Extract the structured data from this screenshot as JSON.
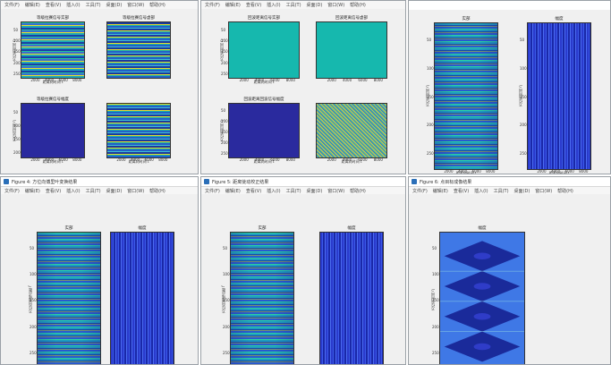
{
  "windows": [
    {
      "id": "w1",
      "title": "",
      "menus": [],
      "panels": [
        {
          "title": "等级拉赛信号实部",
          "style": "stripes-h",
          "xlabel": "距离向时间 t",
          "ylabel": "方位向时间 η",
          "xticks": [
            "2000",
            "4000",
            "6000",
            "8000"
          ],
          "yticks": [
            "50",
            "100",
            "150",
            "200",
            "250"
          ]
        },
        {
          "title": "等级拉赛信号虚部",
          "style": "stripes-hb",
          "xlabel": "",
          "ylabel": "",
          "xticks": [],
          "yticks": []
        },
        {
          "title": "等级拉赛信号幅度",
          "style": "bg-navy",
          "xlabel": "距离向时间 t",
          "ylabel": "方位向时间 η",
          "xticks": [
            "2000",
            "4000",
            "6000",
            "8000"
          ],
          "yticks": [
            "50",
            "100",
            "150",
            "200"
          ]
        },
        {
          "title": "",
          "style": "stripes-hb",
          "xlabel": "距离向时间 t",
          "ylabel": "",
          "xticks": [
            "2000",
            "4000",
            "6000",
            "8000"
          ],
          "yticks": []
        }
      ]
    },
    {
      "id": "w2",
      "title": "",
      "menus": [],
      "panels": [
        {
          "title": "回波距离信号实部",
          "style": "bg-teal",
          "xlabel": "距离向时间 t",
          "ylabel": "方位向时间 η",
          "xticks": [
            "2000",
            "4000",
            "6000",
            "8000"
          ],
          "yticks": [
            "50",
            "100",
            "150",
            "200",
            "250"
          ]
        },
        {
          "title": "回波距离信号虚部",
          "style": "bg-teal",
          "xlabel": "",
          "ylabel": "",
          "xticks": [
            "2000",
            "4000",
            "6000",
            "8000"
          ],
          "yticks": []
        },
        {
          "title": "回波距离回波信号幅度",
          "style": "bg-navy",
          "xlabel": "距离向时间 t",
          "ylabel": "方位向时间 η",
          "xticks": [
            "2000",
            "4000",
            "6000",
            "8000"
          ],
          "yticks": [
            "50",
            "100",
            "150",
            "200",
            "250"
          ]
        },
        {
          "title": "",
          "style": "noise",
          "xlabel": "距离向时间 t",
          "ylabel": "",
          "xticks": [
            "2000",
            "4000",
            "6000",
            "8000"
          ],
          "yticks": []
        }
      ]
    },
    {
      "id": "w3",
      "title": "",
      "menus": [],
      "panels": [
        {
          "title": "实部",
          "style": "stripes-v",
          "xlabel": "距离向时间 t",
          "ylabel": "方位向时间 η",
          "xticks": [
            "2000",
            "4000",
            "6000",
            "8000"
          ],
          "yticks": [
            "50",
            "100",
            "150",
            "200",
            "250"
          ]
        },
        {
          "title": "幅度",
          "style": "stripes-amp",
          "xlabel": "距离向时间 t",
          "ylabel": "方位向时间 η",
          "xticks": [
            "2000",
            "4000",
            "6000",
            "8000"
          ],
          "yticks": [
            "50",
            "100",
            "150",
            "200",
            "250"
          ]
        }
      ]
    },
    {
      "id": "w4",
      "title": "Figure 4: 方位向傅里叶变换结果",
      "menus": [
        "文件(F)",
        "编辑(E)",
        "查看(V)",
        "插入(I)",
        "工具(T)",
        "桌面(D)",
        "窗口(W)",
        "帮助(H)"
      ],
      "panels": [
        {
          "title": "实部",
          "style": "stripes-v",
          "xlabel": "距离向时间 t",
          "ylabel": "方位向频域点数 f",
          "xticks": [
            "2000",
            "4000",
            "6000",
            "8000"
          ],
          "yticks": [
            "50",
            "100",
            "150",
            "200",
            "250"
          ]
        },
        {
          "title": "幅度",
          "style": "stripes-amp",
          "xlabel": "距离向时间 t",
          "ylabel": "",
          "xticks": [
            "2000",
            "4000",
            "6000",
            "8000"
          ],
          "yticks": []
        }
      ]
    },
    {
      "id": "w5",
      "title": "Figure 5: 距离徙动校正结果",
      "menus": [
        "文件(F)",
        "编辑(E)",
        "查看(V)",
        "插入(I)",
        "工具(T)",
        "桌面(D)",
        "窗口(W)",
        "帮助(H)"
      ],
      "panels": [
        {
          "title": "实部",
          "style": "stripes-v",
          "xlabel": "距离向时间 t",
          "ylabel": "方位向频域点数 f",
          "xticks": [
            "2000",
            "4000",
            "6000",
            "8000"
          ],
          "yticks": [
            "50",
            "100",
            "150",
            "200",
            "250"
          ]
        },
        {
          "title": "幅度",
          "style": "stripes-amp",
          "xlabel": "距离向时间 t",
          "ylabel": "",
          "xticks": [
            "2000",
            "4000",
            "6000",
            "8000"
          ],
          "yticks": []
        }
      ]
    },
    {
      "id": "w6",
      "title": "Figure 6: 点目标成像结果",
      "menus": [
        "文件(F)",
        "编辑(E)",
        "查看(V)",
        "插入(I)",
        "工具(T)",
        "桌面(D)",
        "窗口(W)",
        "帮助(H)"
      ],
      "panels": [
        {
          "title": "幅度",
          "style": "focus",
          "xlabel": "距离向时间 t",
          "ylabel": "方位向时间 η",
          "xticks": [
            "2000",
            "4000",
            "6000",
            "8000"
          ],
          "yticks": [
            "50",
            "100",
            "150",
            "200",
            "250"
          ]
        }
      ]
    }
  ],
  "top_menus": [
    "文件(F)",
    "编辑(E)",
    "查看(V)",
    "插入(I)",
    "工具(T)",
    "桌面(D)",
    "窗口(W)",
    "帮助(H)"
  ],
  "colors": {
    "window_bg": "#f0f0f0",
    "navy": "#2a2a9e",
    "teal": "#16b8ae",
    "accent": "#2b6fb8"
  }
}
